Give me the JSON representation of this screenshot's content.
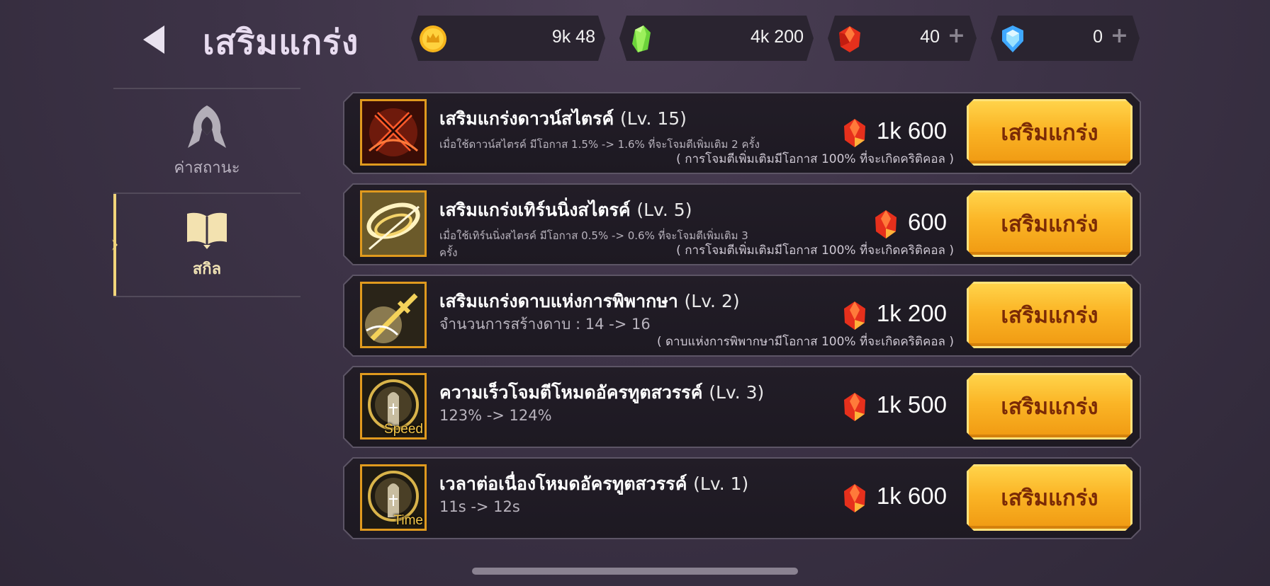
{
  "header": {
    "title": "เสริมแกร่ง",
    "currencies": [
      {
        "name": "gold",
        "icon": "gold-coin-icon",
        "amount": "9k 48",
        "has_plus": false
      },
      {
        "name": "green-crystal",
        "icon": "green-crystal-icon",
        "amount": "4k 200",
        "has_plus": false
      },
      {
        "name": "red-gem",
        "icon": "red-gem-icon",
        "amount": "40",
        "has_plus": true
      },
      {
        "name": "blue-diamond",
        "icon": "blue-diamond-icon",
        "amount": "0",
        "has_plus": true
      }
    ],
    "plus_symbol": "+"
  },
  "sidebar": {
    "tabs": [
      {
        "label": "ค่าสถานะ",
        "icon": "hooded-figure-icon",
        "active": false
      },
      {
        "label": "สกิล",
        "icon": "open-book-icon",
        "active": true
      }
    ]
  },
  "skills": [
    {
      "name": "เสริมแกร่งดาวน์สไตรค์",
      "level": "(Lv. 15)",
      "desc": "เมื่อใช้ดาวน์สไตรค์ มีโอกาส 1.5% -> 1.6% ที่จะโจมตีเพิ่มเติม 2 ครั้ง",
      "note": "( การโจมตีเพิ่มเติมมีโอกาส 100% ที่จะเกิดคริติคอล )",
      "cost": "1k 600",
      "button": "เสริมแกร่ง",
      "icon": "crossed-swords-icon",
      "tag": ""
    },
    {
      "name": "เสริมแกร่งเทิร์นนิ่งสไตรค์",
      "level": "(Lv. 5)",
      "desc": "เมื่อใช้เทิร์นนิ่งสไตรค์ มีโอกาส 0.5% -> 0.6% ที่จะโจมตีเพิ่มเติม 3 ครั้ง",
      "note": "( การโจมตีเพิ่มเติมมีโอกาส 100% ที่จะเกิดคริติคอล )",
      "cost": "600",
      "button": "เสริมแกร่ง",
      "icon": "spinning-slash-icon",
      "tag": ""
    },
    {
      "name": "เสริมแกร่งดาบแห่งการพิพากษา",
      "level": "(Lv. 2)",
      "desc": "จำนวนการสร้างดาบ : 14 -> 16",
      "note": "( ดาบแห่งการพิพากษามีโอกาส 100% ที่จะเกิดคริติคอล )",
      "cost": "1k 200",
      "button": "เสริมแกร่ง",
      "icon": "judgment-sword-icon",
      "tag": ""
    },
    {
      "name": "ความเร็วโจมตีโหมดอัครทูตสวรรค์",
      "level": "(Lv. 3)",
      "desc": "123% -> 124%",
      "note": "",
      "cost": "1k 500",
      "button": "เสริมแกร่ง",
      "icon": "praying-hand-icon",
      "tag": "Speed"
    },
    {
      "name": "เวลาต่อเนื่องโหมดอัครทูตสวรรค์",
      "level": "(Lv. 1)",
      "desc": "11s -> 12s",
      "note": "",
      "cost": "1k 600",
      "button": "เสริมแกร่ง",
      "icon": "praying-hand-icon",
      "tag": "Time"
    }
  ],
  "colors": {
    "accent_gold": "#fbb526",
    "button_text": "#7a2a06",
    "panel_bg": "#1d1922"
  }
}
